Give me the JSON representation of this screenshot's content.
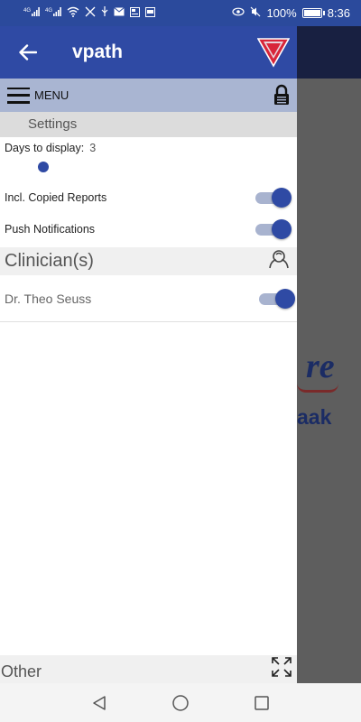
{
  "status_bar": {
    "left_icons": [
      "signal-icon",
      "signal-icon",
      "wifi-icon",
      "muted-alarm-icon",
      "usb-icon",
      "mail-icon",
      "news-icon",
      "gallery-icon"
    ],
    "network_1": "4G",
    "network_2": "4G",
    "battery_percent": "100%",
    "time": "8:36",
    "battery_level": 1.0
  },
  "app_bar": {
    "title": "vpath",
    "back_icon": "arrow-left-icon",
    "logo_icon": "vpath-logo-icon"
  },
  "menu_bar": {
    "label": "MENU",
    "lock_icon": "lock-icon"
  },
  "settings": {
    "header": "Settings",
    "days_label": "Days to display:",
    "days_value": "3",
    "toggles": [
      {
        "label": "Incl. Copied Reports",
        "on": true
      },
      {
        "label": "Push Notifications",
        "on": true
      }
    ]
  },
  "clinicians": {
    "header": "Clinician(s)",
    "items": [
      {
        "name": "Dr. Theo Seuss",
        "on": true
      }
    ]
  },
  "other": {
    "label": "Other"
  },
  "colors": {
    "primary": "#2f4aa4",
    "menu_bar": "#a9b5d2",
    "accent_red": "#d8263a"
  }
}
